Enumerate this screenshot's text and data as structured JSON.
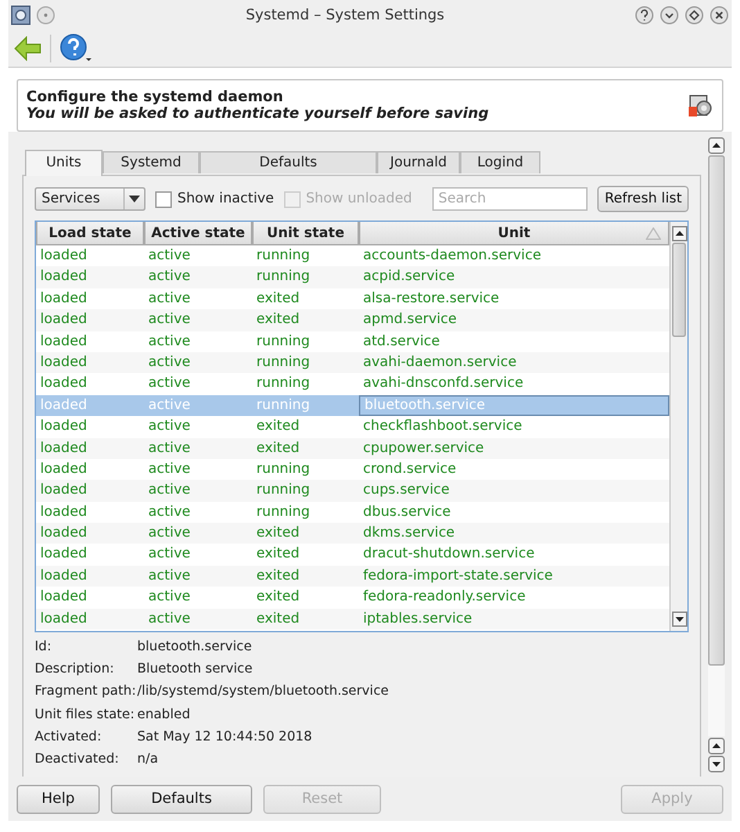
{
  "window": {
    "title": "Systemd – System Settings"
  },
  "header": {
    "title": "Configure the systemd daemon",
    "subtitle": "You will be asked to authenticate yourself before saving"
  },
  "tabs": [
    {
      "label": "Units",
      "selected": true
    },
    {
      "label": "Systemd",
      "selected": false
    },
    {
      "label": "Defaults",
      "selected": false
    },
    {
      "label": "Journald",
      "selected": false
    },
    {
      "label": "Logind",
      "selected": false
    }
  ],
  "filter": {
    "unit_type": "Services",
    "checkboxes": [
      {
        "label": "Show inactive",
        "checked": false,
        "disabled": false
      },
      {
        "label": "Show unloaded",
        "checked": false,
        "disabled": true
      }
    ],
    "search": {
      "placeholder": "Search"
    },
    "refresh_button": "Refresh list"
  },
  "table": {
    "columns": [
      {
        "label": "Load state",
        "sorted": false
      },
      {
        "label": "Active state",
        "sorted": false
      },
      {
        "label": "Unit state",
        "sorted": false
      },
      {
        "label": "Unit",
        "sorted": true
      }
    ],
    "rows": [
      {
        "load": "loaded",
        "active": "active",
        "sub": "running",
        "unit": "accounts-daemon.service",
        "selected": false
      },
      {
        "load": "loaded",
        "active": "active",
        "sub": "running",
        "unit": "acpid.service",
        "selected": false
      },
      {
        "load": "loaded",
        "active": "active",
        "sub": "exited",
        "unit": "alsa-restore.service",
        "selected": false
      },
      {
        "load": "loaded",
        "active": "active",
        "sub": "exited",
        "unit": "apmd.service",
        "selected": false
      },
      {
        "load": "loaded",
        "active": "active",
        "sub": "running",
        "unit": "atd.service",
        "selected": false
      },
      {
        "load": "loaded",
        "active": "active",
        "sub": "running",
        "unit": "avahi-daemon.service",
        "selected": false
      },
      {
        "load": "loaded",
        "active": "active",
        "sub": "running",
        "unit": "avahi-dnsconfd.service",
        "selected": false
      },
      {
        "load": "loaded",
        "active": "active",
        "sub": "running",
        "unit": "bluetooth.service",
        "selected": true
      },
      {
        "load": "loaded",
        "active": "active",
        "sub": "exited",
        "unit": "checkflashboot.service",
        "selected": false
      },
      {
        "load": "loaded",
        "active": "active",
        "sub": "exited",
        "unit": "cpupower.service",
        "selected": false
      },
      {
        "load": "loaded",
        "active": "active",
        "sub": "running",
        "unit": "crond.service",
        "selected": false
      },
      {
        "load": "loaded",
        "active": "active",
        "sub": "running",
        "unit": "cups.service",
        "selected": false
      },
      {
        "load": "loaded",
        "active": "active",
        "sub": "running",
        "unit": "dbus.service",
        "selected": false
      },
      {
        "load": "loaded",
        "active": "active",
        "sub": "exited",
        "unit": "dkms.service",
        "selected": false
      },
      {
        "load": "loaded",
        "active": "active",
        "sub": "exited",
        "unit": "dracut-shutdown.service",
        "selected": false
      },
      {
        "load": "loaded",
        "active": "active",
        "sub": "exited",
        "unit": "fedora-import-state.service",
        "selected": false
      },
      {
        "load": "loaded",
        "active": "active",
        "sub": "exited",
        "unit": "fedora-readonly.service",
        "selected": false
      },
      {
        "load": "loaded",
        "active": "active",
        "sub": "exited",
        "unit": "iptables.service",
        "selected": false
      }
    ]
  },
  "details": [
    {
      "label": "Id:",
      "value": "bluetooth.service"
    },
    {
      "label": "Description:",
      "value": "Bluetooth service"
    },
    {
      "label": "Fragment path:",
      "value": "/lib/systemd/system/bluetooth.service"
    },
    {
      "label": "Unit files state:",
      "value": "enabled"
    },
    {
      "label": "Activated:",
      "value": "Sat May 12 10:44:50 2018"
    },
    {
      "label": "Deactivated:",
      "value": "n/a"
    }
  ],
  "buttons": [
    {
      "label": "Help",
      "disabled": false
    },
    {
      "label": "Defaults",
      "disabled": false
    },
    {
      "label": "Reset",
      "disabled": true
    },
    {
      "label": "Apply",
      "disabled": true
    }
  ]
}
